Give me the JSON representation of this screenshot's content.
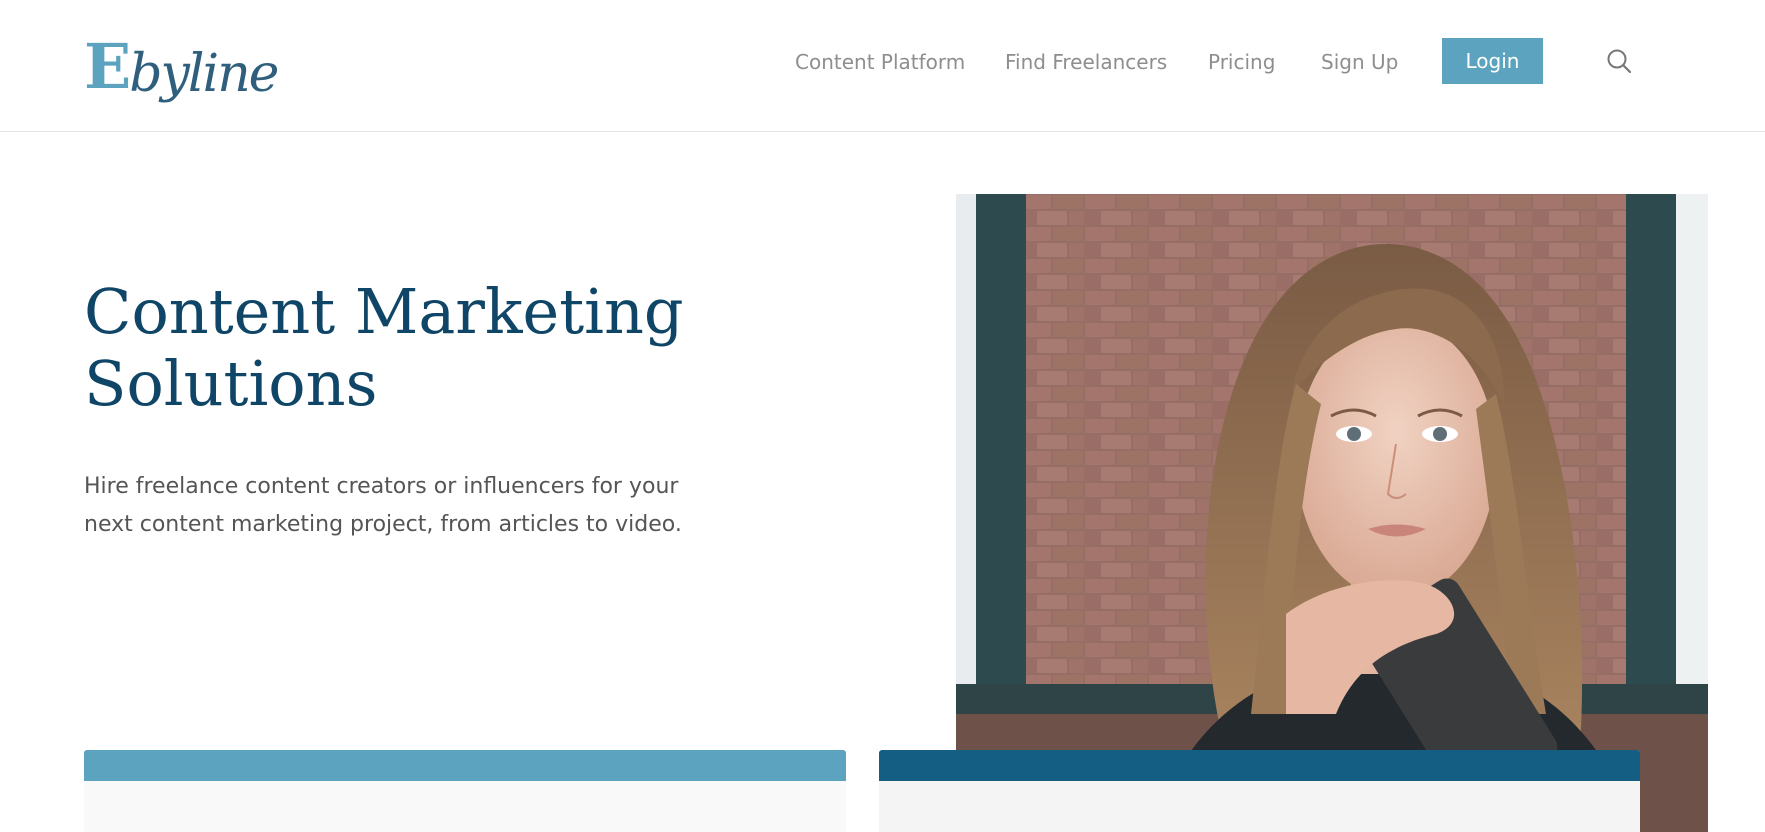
{
  "header": {
    "logo": {
      "initial": "E",
      "rest": "byline"
    },
    "nav": {
      "items": [
        {
          "label": "Content Platform"
        },
        {
          "label": "Find Freelancers"
        },
        {
          "label": "Pricing"
        },
        {
          "label": "Sign Up"
        }
      ],
      "login_label": "Login",
      "search_icon": "search-icon"
    }
  },
  "hero": {
    "title_line1": "Content Marketing",
    "title_line2": "Solutions",
    "subtitle_line1": "Hire freelance content creators or influencers for your",
    "subtitle_line2": "next content marketing project, from articles to video.",
    "photo_icon": "portrait-photo"
  },
  "cards": [
    {
      "accent": "#5ba3be"
    },
    {
      "accent": "#135e82"
    }
  ],
  "colors": {
    "brand_light": "#5ba3be",
    "brand_dark": "#135e82",
    "title": "#0f4566",
    "nav_text": "#8e8e8e"
  }
}
